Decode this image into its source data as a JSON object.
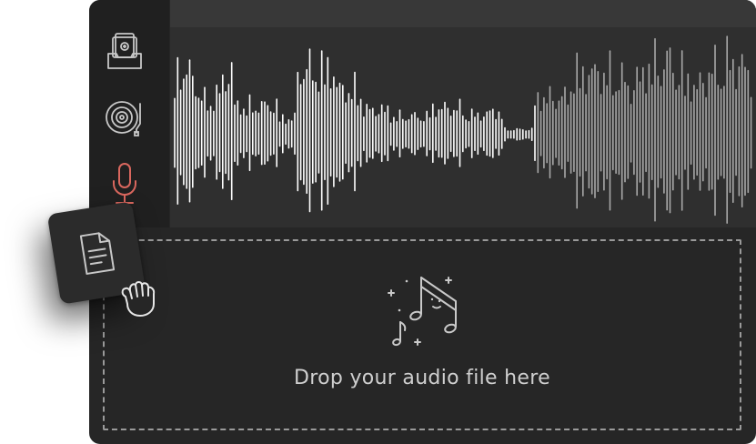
{
  "app": {
    "drop_zone": {
      "label": "Drop your audio file here",
      "icon": "music-notes-icon"
    },
    "sidebar": {
      "items": [
        {
          "name": "record-box",
          "icon": "cassette-box-icon",
          "active": false
        },
        {
          "name": "turntable",
          "icon": "turntable-icon",
          "active": false
        },
        {
          "name": "microphone",
          "icon": "microphone-icon",
          "active": true
        }
      ]
    },
    "dragged_item": {
      "icon": "document-icon",
      "cursor": "grab-hand-icon"
    }
  },
  "colors": {
    "window_bg": "#262626",
    "sidebar_bg": "#202020",
    "waveform_bg": "#2f2f2f",
    "waveform_played": "#ffffff",
    "waveform_unplayed": "#a8a8a8",
    "icon_default": "#c8c8c8",
    "icon_active": "#d9675e",
    "text": "#cfcfcf"
  }
}
